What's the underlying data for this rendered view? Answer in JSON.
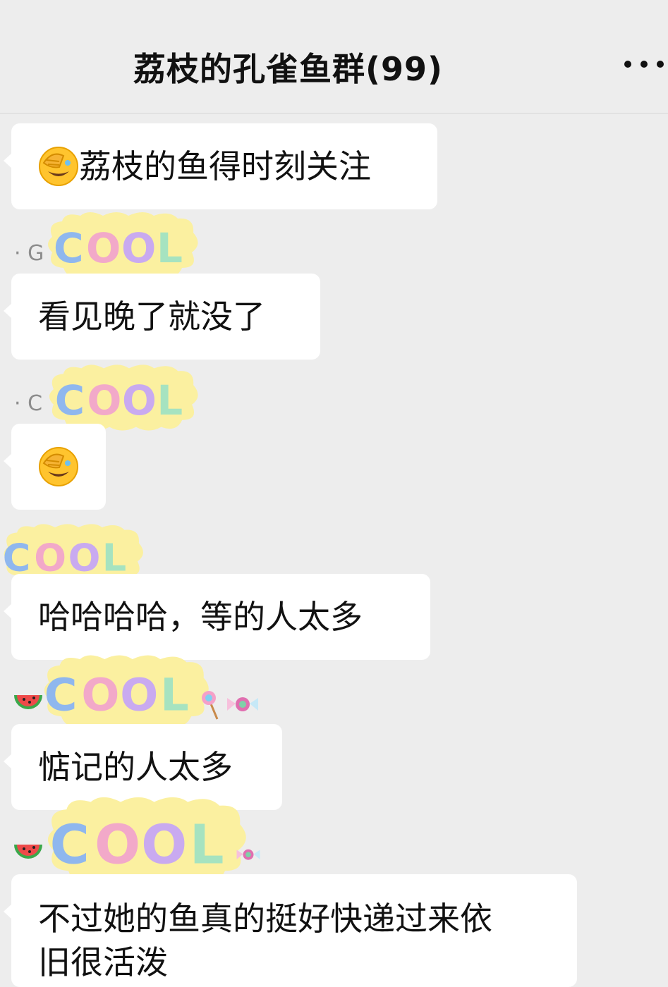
{
  "header": {
    "title": "荔枝的孔雀鱼群(99)",
    "more_icon": "more-dots-icon"
  },
  "messages": [
    {
      "sender": "",
      "text": "荔枝的鱼得时刻关注",
      "emoji": "facepalm-laugh-emoji"
    },
    {
      "sender": "· G",
      "text": "看见晚了就没了"
    },
    {
      "sender": "· C",
      "text": "",
      "emoji": "facepalm-laugh-emoji"
    },
    {
      "sender": "",
      "text": "哈哈哈哈，等的人太多"
    },
    {
      "sender": "",
      "text": "惦记的人太多"
    },
    {
      "sender": "",
      "text": "不过她的鱼真的挺好快递过来依",
      "text_line2": "旧很活泼"
    }
  ],
  "sticker": {
    "word": "COOL",
    "colors": {
      "c": "#8fb7ee",
      "o1": "#f2a9c9",
      "o2": "#c9aaf0",
      "l": "#a6e3c0",
      "cloud": "#fbf0a0"
    }
  },
  "colors": {
    "background": "#ededed",
    "bubble": "#ffffff",
    "text": "#111111"
  }
}
